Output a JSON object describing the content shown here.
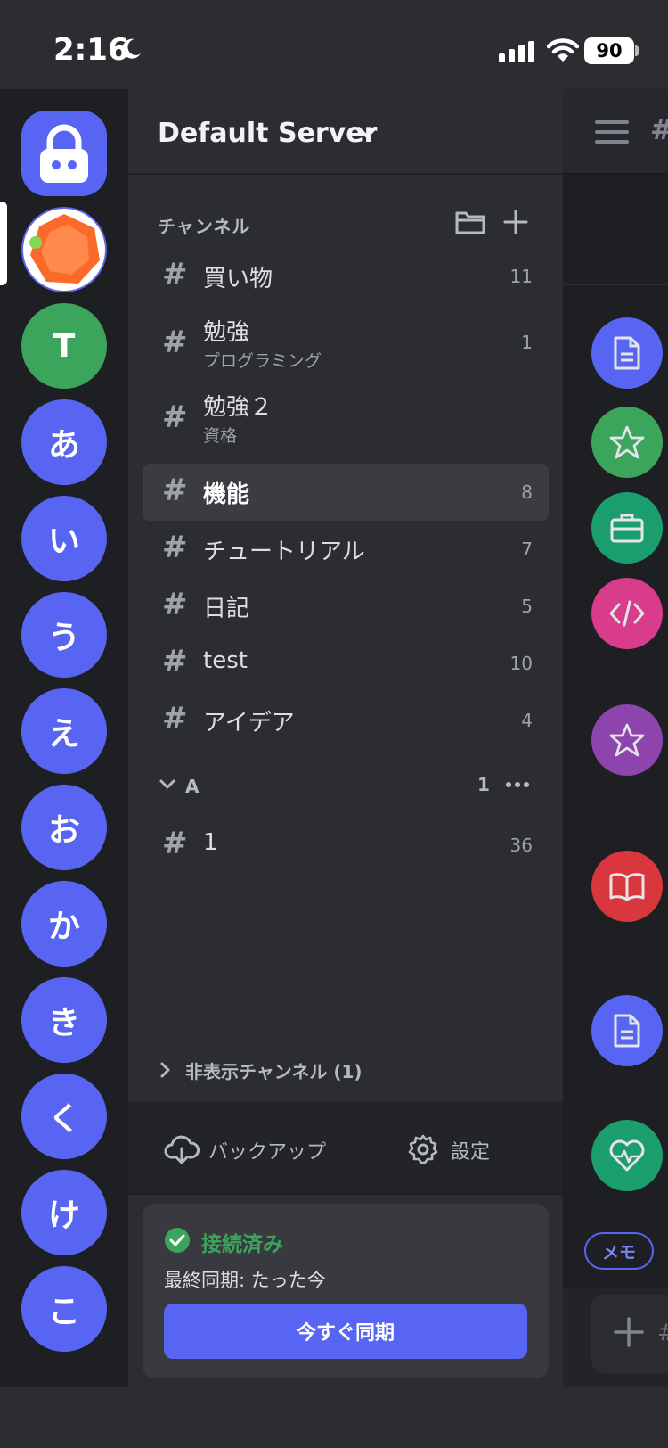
{
  "status_bar": {
    "time": "2:16",
    "battery": "90"
  },
  "servers": [
    "T",
    "あ",
    "い",
    "う",
    "え",
    "お",
    "か",
    "き",
    "く",
    "け",
    "こ"
  ],
  "server": {
    "name": "Default Server"
  },
  "channels_header": "チャンネル",
  "channels": [
    {
      "name": "買い物",
      "count": "11"
    },
    {
      "name": "勉強",
      "sub": "プログラミング",
      "count": "1"
    },
    {
      "name": "勉強２",
      "sub": "資格"
    },
    {
      "name": "機能",
      "count": "8"
    },
    {
      "name": "チュートリアル",
      "count": "7"
    },
    {
      "name": "日記",
      "count": "5"
    },
    {
      "name": "test",
      "count": "10"
    },
    {
      "name": "アイデア",
      "count": "4"
    }
  ],
  "category_a": {
    "label": "A",
    "count": "1",
    "channels": [
      {
        "name": "1",
        "count": "36"
      }
    ]
  },
  "hidden_channels": "非表示チャンネル (1)",
  "bottom_bar": {
    "backup": "バックアップ",
    "settings": "設定"
  },
  "sync": {
    "status": "接続済み",
    "last_sync": "最終同期: たった今",
    "button": "今すぐ同期"
  },
  "peek": {
    "hash": "#",
    "memo_chip": "メモ",
    "input_hash": "#"
  },
  "hash_symbol": "#",
  "colors": {
    "accent": "#5865f2",
    "success": "#3ba55c",
    "rail_bg": "#1e1f22",
    "panel_bg": "#2b2d31",
    "selected_bg": "#3a3c42"
  },
  "icons": {
    "top_server": "lock-icon",
    "peek_items": [
      "document-icon",
      "star-icon",
      "briefcase-icon",
      "code-icon",
      "star-icon",
      "book-icon",
      "document-icon",
      "heart-pulse-icon"
    ]
  }
}
